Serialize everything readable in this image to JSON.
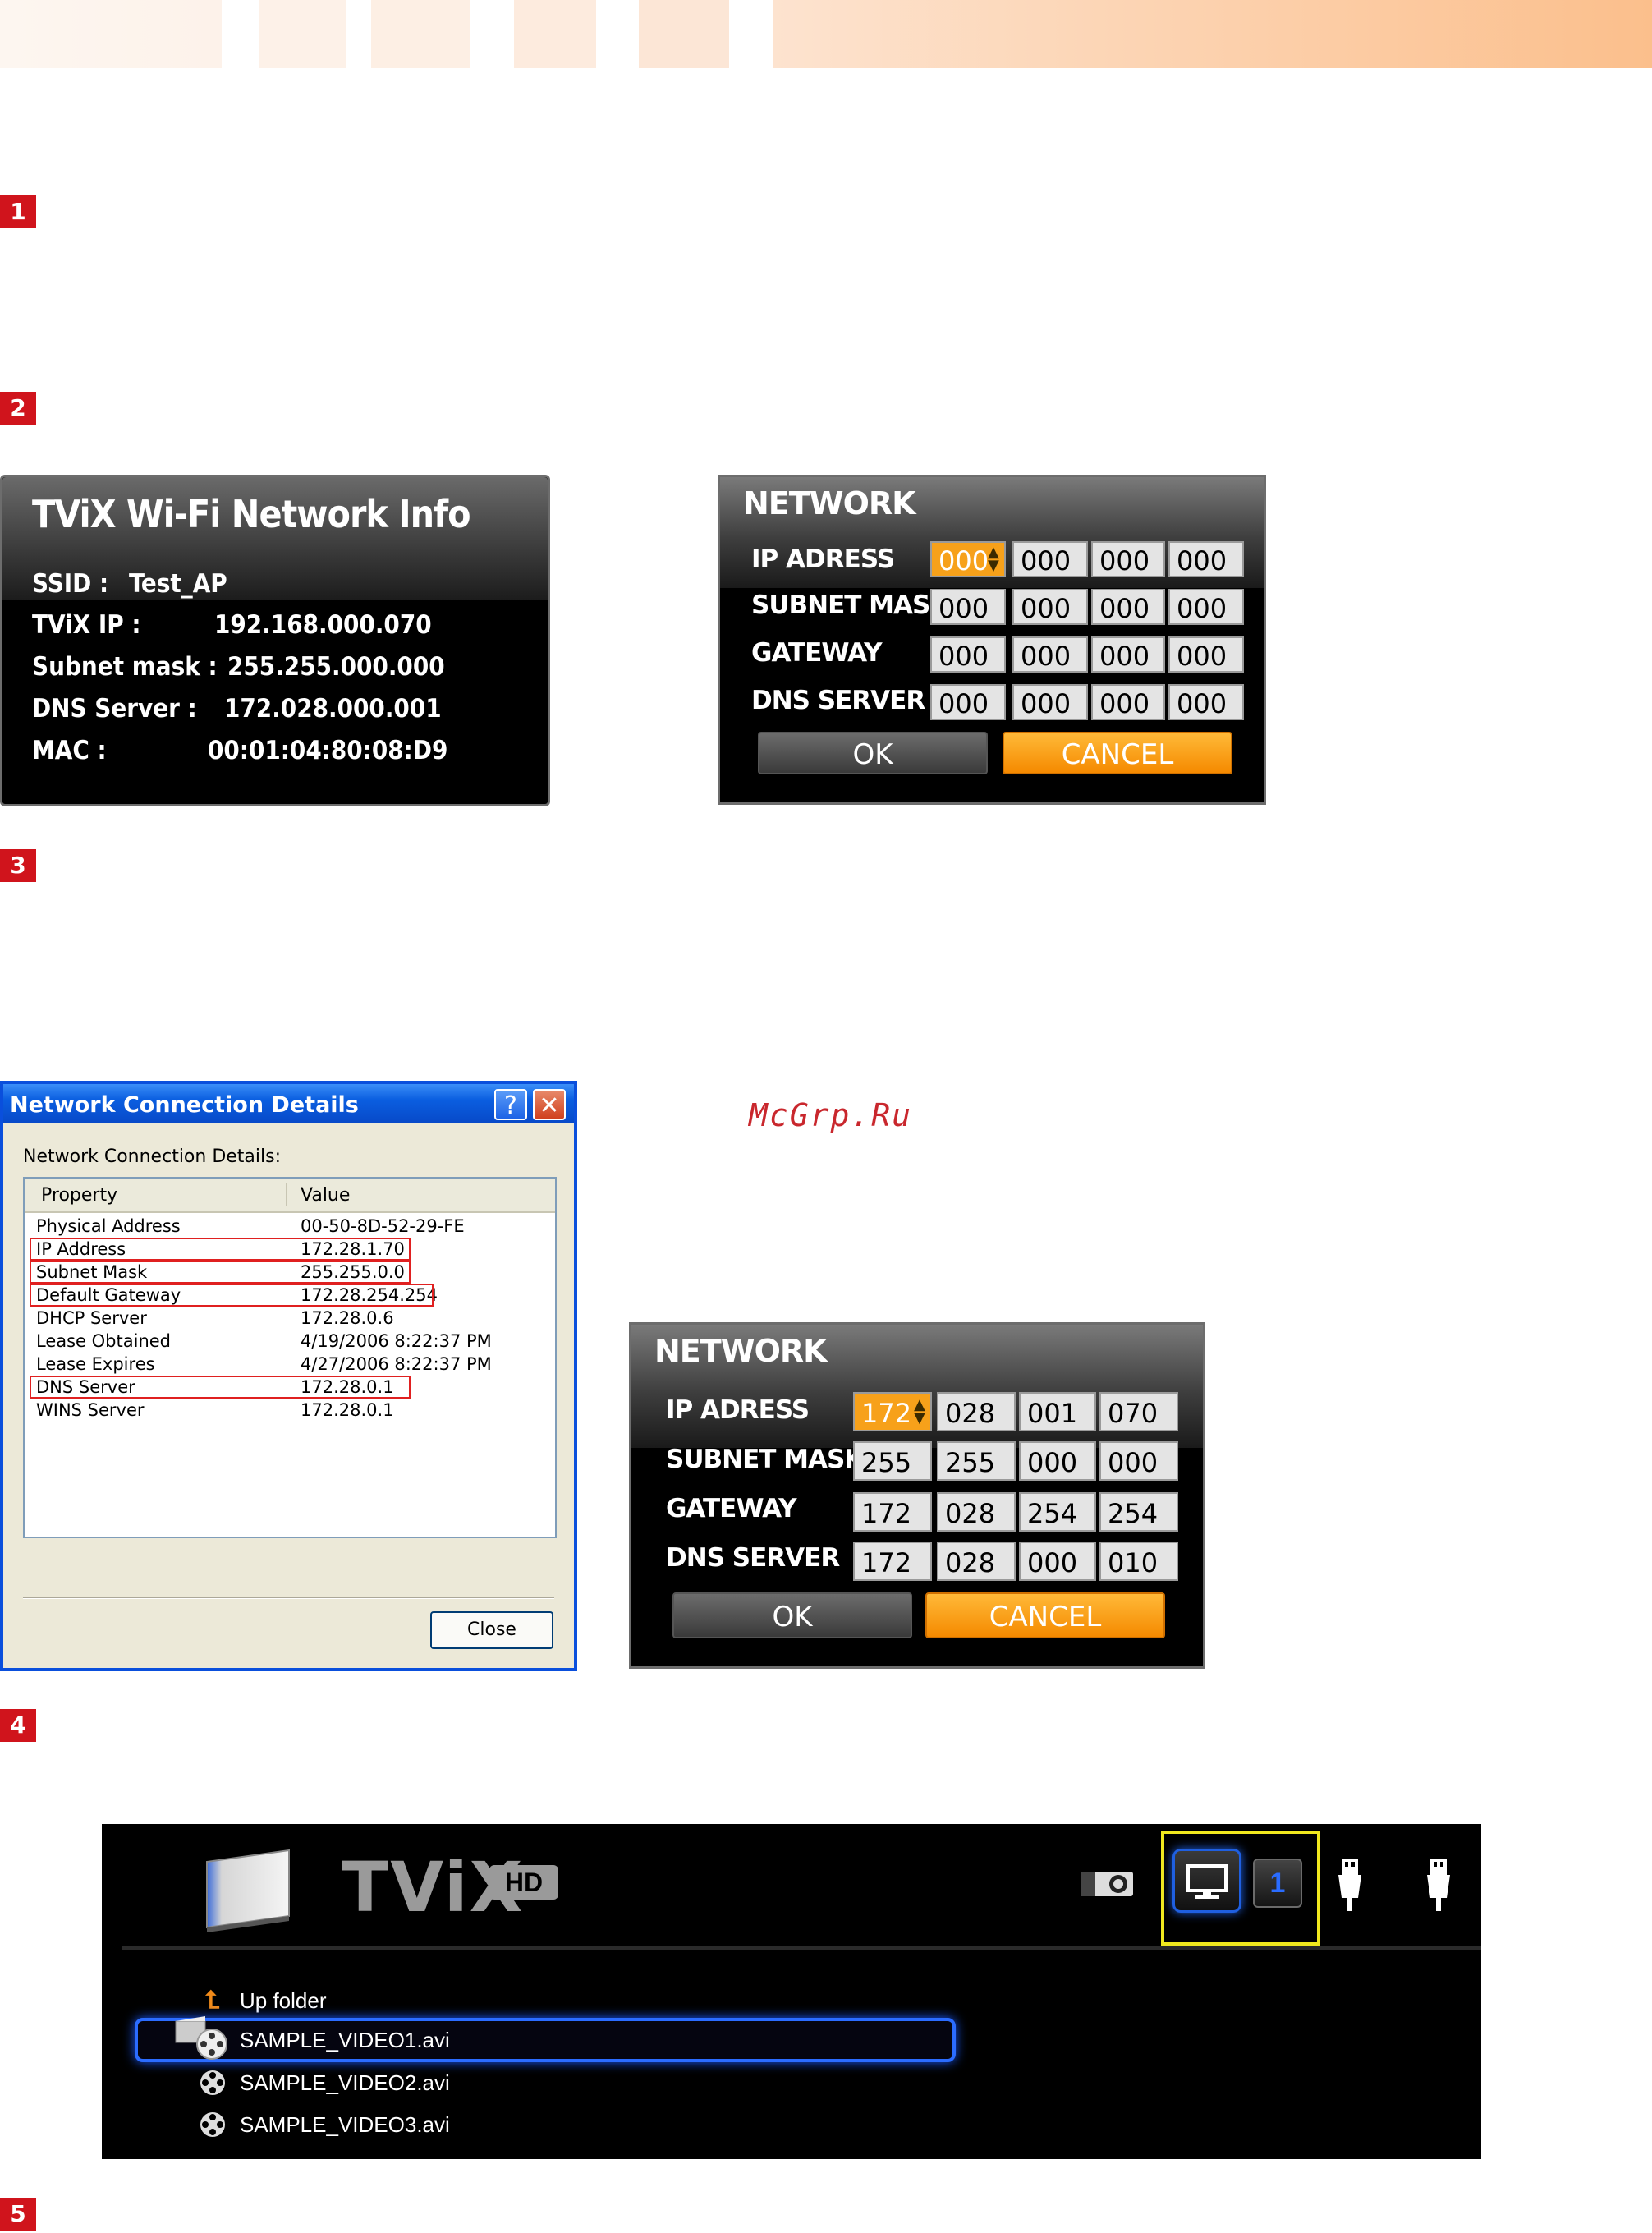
{
  "steps": [
    "1",
    "2",
    "3",
    "4",
    "5"
  ],
  "wifi_info": {
    "title": "TViX Wi-Fi Network Info",
    "rows": [
      {
        "label": "SSID :",
        "value": "Test_AP"
      },
      {
        "label": "TViX IP :",
        "value": "192.168.000.070"
      },
      {
        "label": "Subnet mask :",
        "value": "255.255.000.000"
      },
      {
        "label": "DNS Server :",
        "value": "172.028.000.001"
      },
      {
        "label": "MAC :",
        "value": "00:01:04:80:08:D9"
      }
    ]
  },
  "network_empty": {
    "title": "NETWORK",
    "labels": [
      "IP ADRESS",
      "SUBNET MASK",
      "GATEWAY",
      "DNS SERVER"
    ],
    "values": [
      [
        "000",
        "000",
        "000",
        "000"
      ],
      [
        "000",
        "000",
        "000",
        "000"
      ],
      [
        "000",
        "000",
        "000",
        "000"
      ],
      [
        "000",
        "000",
        "000",
        "000"
      ]
    ],
    "ok": "OK",
    "cancel": "CANCEL"
  },
  "network_filled": {
    "title": "NETWORK",
    "labels": [
      "IP ADRESS",
      "SUBNET MASK",
      "GATEWAY",
      "DNS SERVER"
    ],
    "values": [
      [
        "172",
        "028",
        "001",
        "070"
      ],
      [
        "255",
        "255",
        "000",
        "000"
      ],
      [
        "172",
        "028",
        "254",
        "254"
      ],
      [
        "172",
        "028",
        "000",
        "010"
      ]
    ],
    "ok": "OK",
    "cancel": "CANCEL"
  },
  "win_dialog": {
    "title": "Network Connection Details",
    "help": "?",
    "x": "✕",
    "subtitle": "Network Connection Details:",
    "col_property": "Property",
    "col_value": "Value",
    "rows": [
      {
        "property": "Physical Address",
        "value": "00-50-8D-52-29-FE"
      },
      {
        "property": "IP Address",
        "value": "172.28.1.70"
      },
      {
        "property": "Subnet Mask",
        "value": "255.255.0.0"
      },
      {
        "property": "Default Gateway",
        "value": "172.28.254.254"
      },
      {
        "property": "DHCP Server",
        "value": "172.28.0.6"
      },
      {
        "property": "Lease Obtained",
        "value": "4/19/2006 8:22:37 PM"
      },
      {
        "property": "Lease Expires",
        "value": "4/27/2006 8:22:37 PM"
      },
      {
        "property": "DNS Server",
        "value": "172.28.0.1"
      },
      {
        "property": "WINS Server",
        "value": "172.28.0.1"
      }
    ],
    "close_label": "Close"
  },
  "watermark": "McGrp.Ru",
  "media_player": {
    "logo": "TViX",
    "logo_badge": "HD",
    "device_number": "1",
    "up_folder": "Up folder",
    "files": [
      "SAMPLE_VIDEO1.avi",
      "SAMPLE_VIDEO2.avi",
      "SAMPLE_VIDEO3.avi"
    ]
  },
  "colors": {
    "step_red": "#d0141c",
    "accent_orange": "#f7a11a",
    "xp_blue": "#0a4fdc",
    "highlight_yellow": "#f0e81e",
    "select_blue": "#2b6cff"
  }
}
